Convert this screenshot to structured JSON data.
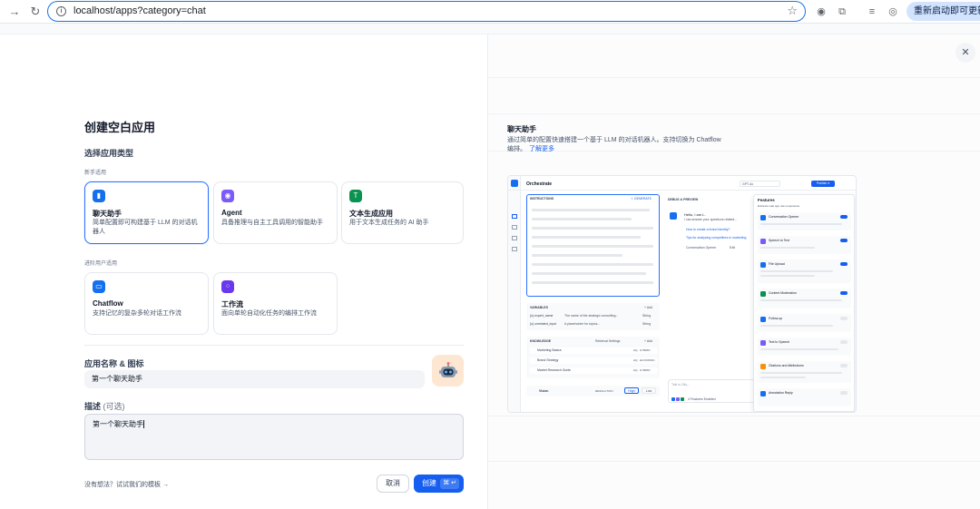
{
  "browser": {
    "url": "localhost/apps?category=chat",
    "update_label": "重新启动即可更新"
  },
  "form": {
    "title": "创建空白应用",
    "type_label": "选择应用类型",
    "beginner_label": "新手适用",
    "advanced_label": "进阶用户适用",
    "cards": [
      {
        "name": "聊天助手",
        "desc": "简单配置即可构建基于 LLM 的对话机器人",
        "color": "#1570ef",
        "icon": "chat-icon"
      },
      {
        "name": "Agent",
        "desc": "具备推理与自主工具调用的智能助手",
        "color": "#7a5af8",
        "icon": "agent-icon"
      },
      {
        "name": "文本生成应用",
        "desc": "用于文本生成任务的 AI 助手",
        "color": "#099250",
        "icon": "text-gen-icon"
      },
      {
        "name": "Chatflow",
        "desc": "支持记忆的复杂多轮对话工作流",
        "color": "#1570ef",
        "icon": "chatflow-icon"
      },
      {
        "name": "工作流",
        "desc": "面向单轮自动化任务的编排工作流",
        "color": "#6938ef",
        "icon": "workflow-icon"
      }
    ],
    "name_label": "应用名称 & 图标",
    "name_value": "第一个聊天助手",
    "avatar": "🤖",
    "desc_label": "描述",
    "desc_optional": "(可选)",
    "desc_value": "第一个聊天助手",
    "template_link": "没有想法？试试我们的模板 →",
    "cancel": "取消",
    "create": "创建",
    "create_kbd": "⌘ ↵"
  },
  "preview": {
    "title": "聊天助手",
    "desc": "通过简单的配置快速搭建一个基于 LLM 的对话机器人。支持切换为 Chatflow 编排。",
    "more": "了解更多",
    "mock": {
      "orchestrate": "Orchestrate",
      "model": "GPT-4o",
      "publish": "Publish ▾",
      "instructions": "INSTRUCTIONS",
      "generate": "✧ GENERATE",
      "variables": "VARIABLES",
      "add": "+ Add",
      "var_rows": [
        {
          "key": "{x} expert_name",
          "desc": "The name of the strategic consulting...",
          "type": "String"
        },
        {
          "key": "{x} unrelated_input",
          "desc": "A placeholder for topics...",
          "type": "String"
        }
      ],
      "knowledge": "KNOWLEDGE",
      "retrieval": "Retrieval Settings",
      "knowledge_rows": [
        {
          "name": "Marketing Basics",
          "tag": "HQ · HYBRID"
        },
        {
          "name": "Brand Strategy",
          "tag": "HQ · ECONOMIC"
        },
        {
          "name": "Market Research Guide",
          "tag": "HQ · HYBRID"
        }
      ],
      "vision": "Vision",
      "resolution": "RESOLUTION",
      "high": "High",
      "low": "Low",
      "debug": "DEBUG & PREVIEW",
      "greeting": "Hello, I am L.",
      "greeting_sub": "I can answer your questions related...",
      "suggest_1": "How to create a brand identity?",
      "suggest_2": "Tips for analyzing competitors in marketing",
      "opener": "Conversation Opener",
      "edit": "Edit",
      "talk": "Talk to Dify...",
      "features_enabled": "4 Features Enabled",
      "features_title": "Features",
      "features_sub": "Enhance web app user experience",
      "features": [
        {
          "name": "Conversation Opener",
          "color": "#1570ef",
          "on": true
        },
        {
          "name": "Speech to Text",
          "color": "#7a5af8",
          "on": true
        },
        {
          "name": "File Upload",
          "color": "#1570ef",
          "on": true
        },
        {
          "name": "Content Moderation",
          "color": "#099250",
          "on": true
        },
        {
          "name": "Follow-up",
          "color": "#1570ef",
          "on": false
        },
        {
          "name": "Text to Speech",
          "color": "#7a5af8",
          "on": false
        },
        {
          "name": "Citations and Attributions",
          "color": "#f79009",
          "on": false
        },
        {
          "name": "Annotation Reply",
          "color": "#1570ef",
          "on": false
        }
      ]
    }
  }
}
